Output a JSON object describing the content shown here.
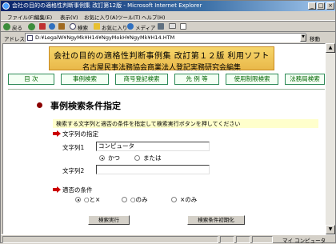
{
  "window": {
    "title": "会社の目的の適格性判断事例集 改訂第12版 - Microsoft Internet Explorer",
    "minimize": "_",
    "maximize": "□",
    "close": "×"
  },
  "menu": [
    "ファイル(F)",
    "編集(E)",
    "表示(V)",
    "お気に入り(A)",
    "ツール(T)",
    "ヘルプ(H)"
  ],
  "toolbar": {
    "back": "戻る",
    "search": "検索",
    "favorites": "お気に入り",
    "media": "メディア"
  },
  "address": {
    "label": "アドレス(D)",
    "value": "D:¥LegalW¥NgyMk¥H14¥NgyMokH¥NgyMk¥H14.HTM",
    "go": "移動"
  },
  "banner": {
    "line1": "会社の目的の適格性判断事例集 改訂第１２版 利用ソフト",
    "line2": "名古屋民事法務協会商業法人登記実務研究会編集"
  },
  "nav": [
    "目 次",
    "事例検索",
    "商号登記検索",
    "先 例 等",
    "使用制限検索",
    "法務局検索"
  ],
  "page": {
    "heading": "事例検索条件指定",
    "instruction": "検索する文字列と適否の条件を指定して検索実行ボタンを押してください",
    "text_section": "文字列の指定",
    "label1": "文字列1",
    "value1": "コンピュータ",
    "and_label": "かつ",
    "or_label": "または",
    "label2": "文字列2",
    "value2": "",
    "cond_section": "適否の条件",
    "cond_both": "○と×",
    "cond_ok": "○のみ",
    "cond_ng": "×のみ",
    "search_button": "検索実行",
    "reset_button": "検索条件初期化"
  },
  "status": {
    "zone": "マイ コンピュータ"
  },
  "colors": {
    "banner": "#f0c85a",
    "nav_text": "#006400",
    "bullet": "#8b0000",
    "arrow": "#cc0000",
    "instruction_bg": "#ffffcc"
  }
}
